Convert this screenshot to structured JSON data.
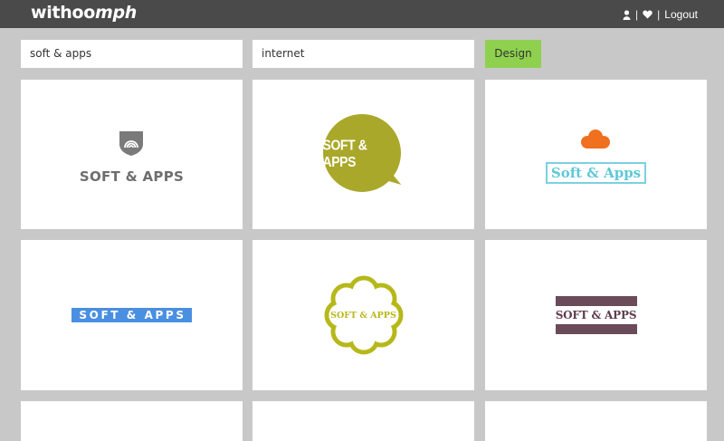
{
  "header": {
    "brand_a": "withoo",
    "brand_b": "mph",
    "separator": "|",
    "logout_label": "Logout"
  },
  "search": {
    "keyword_value": "soft & apps",
    "category_value": "internet",
    "design_label": "Design"
  },
  "logos": [
    {
      "text": "SOFT & APPS",
      "color": "#6e6e6e",
      "icon": "shield-wifi-icon"
    },
    {
      "text": "SOFT & APPS",
      "color": "#aaa82a",
      "icon": "speech-bubble-icon"
    },
    {
      "text": "Soft & Apps",
      "color": "#5fc8d8",
      "icon": "cloud-icon"
    },
    {
      "text": "SOFT & APPS",
      "color": "#4a8fe0"
    },
    {
      "text": "SOFT & APPS",
      "color": "#b6b81a",
      "icon": "flower-badge-icon"
    },
    {
      "text": "SOFT & APPS",
      "color": "#6b4a5a"
    }
  ],
  "colors": {
    "header_bg": "#4a4a4a",
    "page_bg": "#c8c8c8",
    "accent_button": "#8fd14f",
    "card_bg": "#ffffff"
  }
}
